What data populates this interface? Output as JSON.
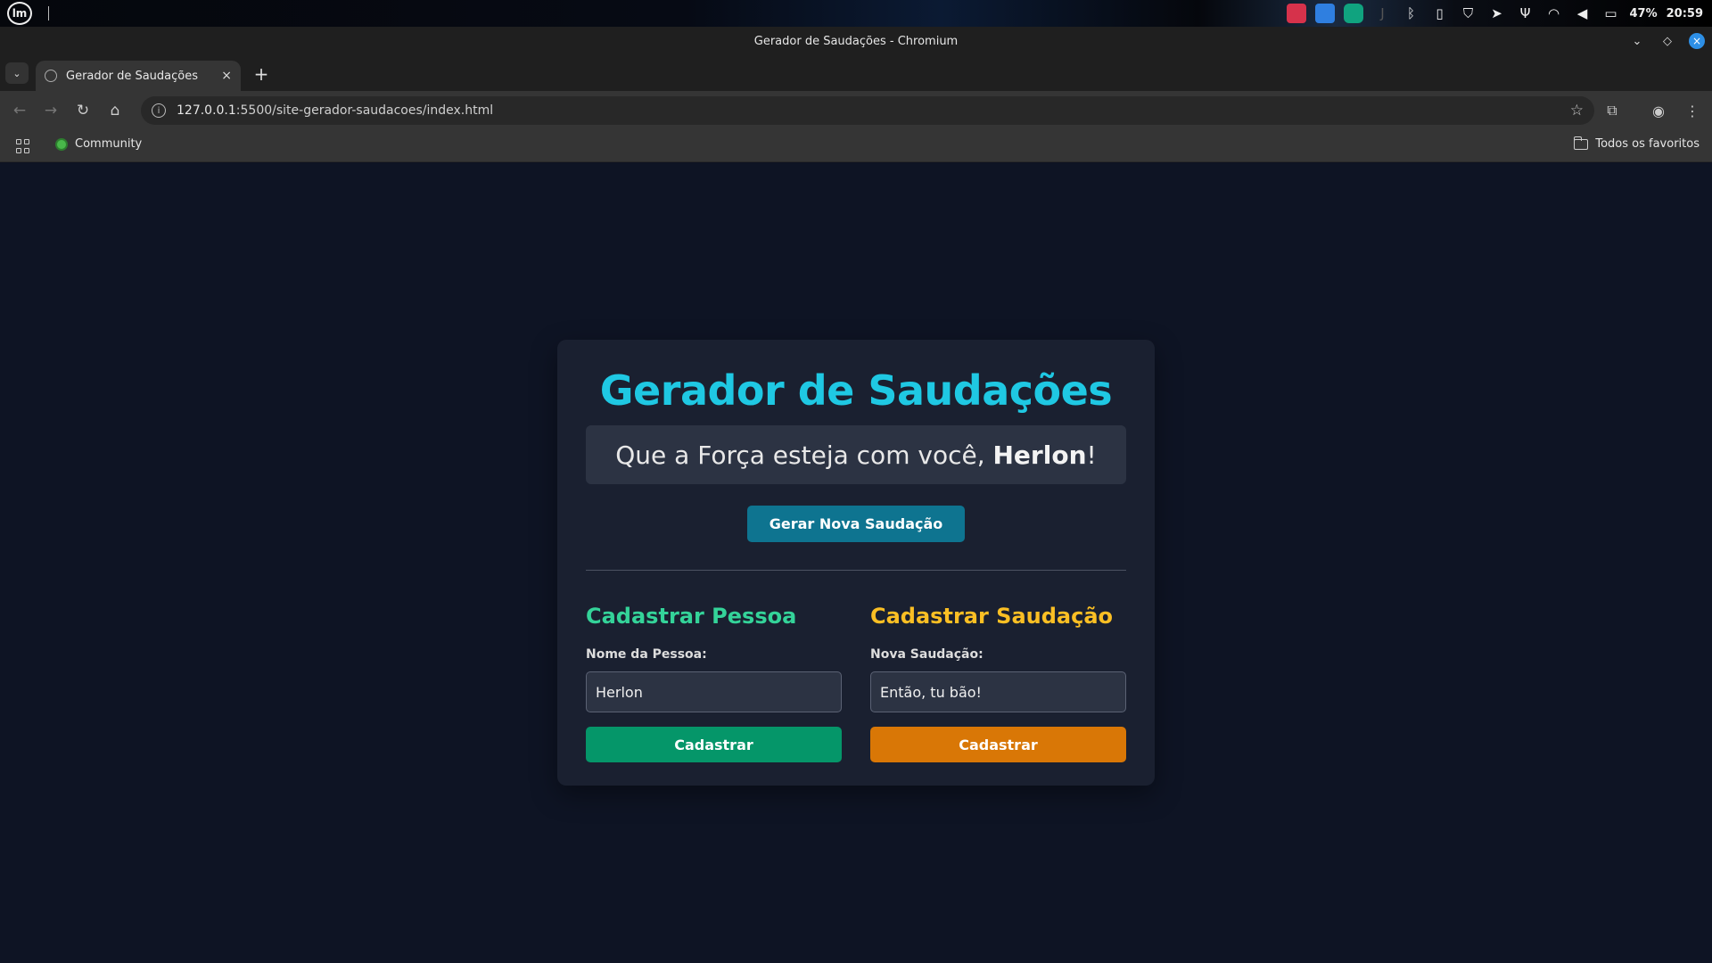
{
  "os_panel": {
    "logo": "lm",
    "battery": "47%",
    "clock": "20:59"
  },
  "window": {
    "title": "Gerador de Saudações - Chromium"
  },
  "tabs": [
    {
      "title": "Gerador de Saudações",
      "close": "×"
    }
  ],
  "toolbar": {
    "url_host": "127.0.0.1",
    "url_rest": ":5500/site-gerador-saudacoes/index.html"
  },
  "bookmarks": {
    "items": [
      {
        "label": "Community"
      }
    ],
    "all_label": "Todos os favoritos"
  },
  "page": {
    "title": "Gerador de Saudações",
    "greeting_prefix": "Que a Força esteja com você, ",
    "greeting_name": "Herlon",
    "greeting_suffix": "!",
    "generate_button": "Gerar Nova Saudação",
    "person_form": {
      "title": "Cadastrar Pessoa",
      "label": "Nome da Pessoa:",
      "value": "Herlon",
      "button": "Cadastrar"
    },
    "greeting_form": {
      "title": "Cadastrar Saudação",
      "label": "Nova Saudação:",
      "value": "Então, tu bão!",
      "button": "Cadastrar"
    }
  },
  "colors": {
    "title_cyan": "#1fc8e3",
    "green": "#34d399",
    "yellow": "#fbbf24",
    "generate_btn": "#0e7490",
    "green_btn": "#059669",
    "orange_btn": "#d97706"
  }
}
